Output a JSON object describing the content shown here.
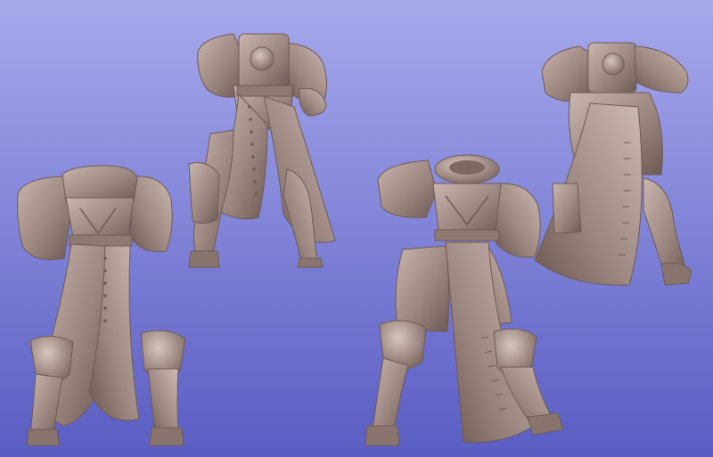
{
  "scene": {
    "background": {
      "top_color": "#a7a9ec",
      "bottom_color": "#5a5dc2"
    },
    "material_color": "#9c8780",
    "material_shadow": "#6e5a55",
    "material_highlight": "#c9b6ae",
    "figures": [
      {
        "name": "figure-back-view"
      },
      {
        "name": "figure-front-view-left"
      },
      {
        "name": "figure-front-view-center"
      },
      {
        "name": "figure-side-back-view"
      }
    ]
  }
}
